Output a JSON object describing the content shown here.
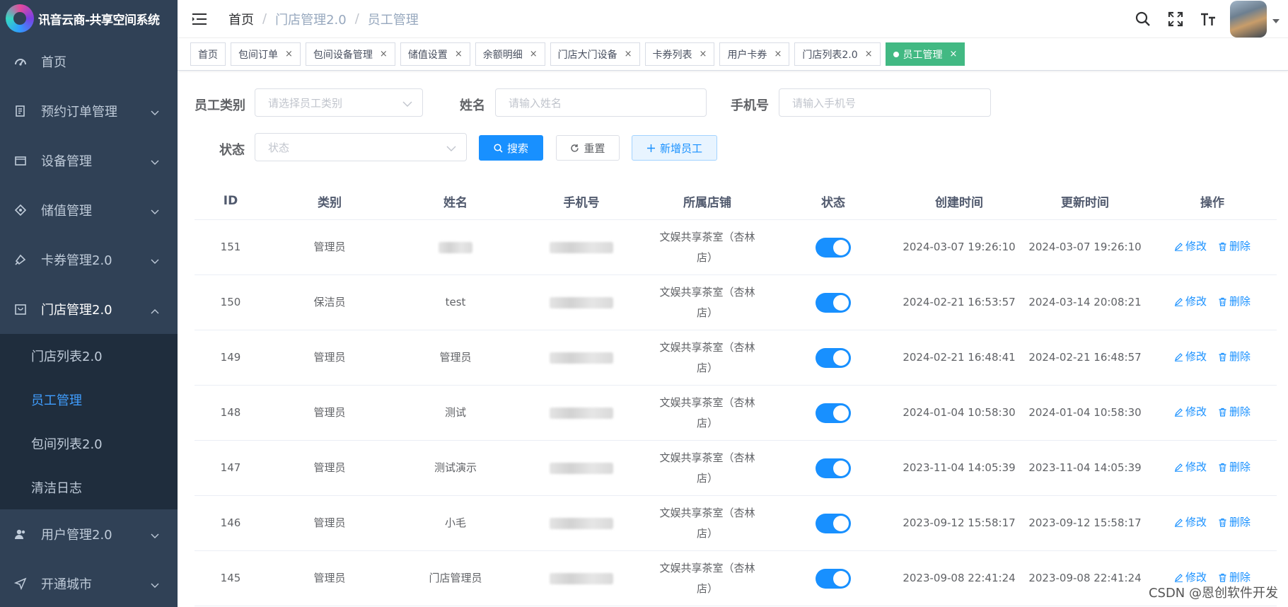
{
  "app": {
    "title": "讯音云商-共享空间系统"
  },
  "sidebar": {
    "items": [
      {
        "label": "首页",
        "icon": "dashboard-icon"
      },
      {
        "label": "预约订单管理",
        "icon": "order-icon"
      },
      {
        "label": "设备管理",
        "icon": "device-icon"
      },
      {
        "label": "储值管理",
        "icon": "wallet-icon"
      },
      {
        "label": "卡券管理2.0",
        "icon": "coupon-icon"
      },
      {
        "label": "门店管理2.0",
        "icon": "store-icon"
      },
      {
        "label": "用户管理2.0",
        "icon": "user-icon"
      },
      {
        "label": "开通城市",
        "icon": "send-icon"
      }
    ],
    "submenu": [
      {
        "label": "门店列表2.0"
      },
      {
        "label": "员工管理"
      },
      {
        "label": "包间列表2.0"
      },
      {
        "label": "清洁日志"
      }
    ]
  },
  "breadcrumb": [
    "首页",
    "门店管理2.0",
    "员工管理"
  ],
  "tags": [
    {
      "label": "首页",
      "closable": false
    },
    {
      "label": "包间订单",
      "closable": true
    },
    {
      "label": "包间设备管理",
      "closable": true
    },
    {
      "label": "储值设置",
      "closable": true
    },
    {
      "label": "余额明细",
      "closable": true
    },
    {
      "label": "门店大门设备",
      "closable": true
    },
    {
      "label": "卡券列表",
      "closable": true
    },
    {
      "label": "用户卡券",
      "closable": true
    },
    {
      "label": "门店列表2.0",
      "closable": true
    },
    {
      "label": "员工管理",
      "closable": true,
      "active": true
    }
  ],
  "filters": {
    "type_label": "员工类别",
    "type_placeholder": "请选择员工类别",
    "name_label": "姓名",
    "name_placeholder": "请输入姓名",
    "phone_label": "手机号",
    "phone_placeholder": "请输入手机号",
    "status_label": "状态",
    "status_placeholder": "状态"
  },
  "buttons": {
    "search": "搜索",
    "reset": "重置",
    "add": "新增员工"
  },
  "table": {
    "headers": [
      "ID",
      "类别",
      "姓名",
      "手机号",
      "所属店铺",
      "状态",
      "创建时间",
      "更新时间",
      "操作"
    ],
    "edit_label": "修改",
    "delete_label": "删除",
    "rows": [
      {
        "id": "151",
        "type": "管理员",
        "name": "",
        "store": "文娱共享茶室（杏林店）",
        "status": true,
        "created": "2024-03-07 19:26:10",
        "updated": "2024-03-07 19:26:10"
      },
      {
        "id": "150",
        "type": "保洁员",
        "name": "test",
        "store": "文娱共享茶室（杏林店）",
        "status": true,
        "created": "2024-02-21 16:53:57",
        "updated": "2024-03-14 20:08:21"
      },
      {
        "id": "149",
        "type": "管理员",
        "name": "管理员",
        "store": "文娱共享茶室（杏林店）",
        "status": true,
        "created": "2024-02-21 16:48:41",
        "updated": "2024-02-21 16:48:57"
      },
      {
        "id": "148",
        "type": "管理员",
        "name": "测试",
        "store": "文娱共享茶室（杏林店）",
        "status": true,
        "created": "2024-01-04 10:58:30",
        "updated": "2024-01-04 10:58:30"
      },
      {
        "id": "147",
        "type": "管理员",
        "name": "测试演示",
        "store": "文娱共享茶室（杏林店）",
        "status": true,
        "created": "2023-11-04 14:05:39",
        "updated": "2023-11-04 14:05:39"
      },
      {
        "id": "146",
        "type": "管理员",
        "name": "小毛",
        "store": "文娱共享茶室（杏林店）",
        "status": true,
        "created": "2023-09-12 15:58:17",
        "updated": "2023-09-12 15:58:17"
      },
      {
        "id": "145",
        "type": "管理员",
        "name": "门店管理员",
        "store": "文娱共享茶室（杏林店）",
        "status": true,
        "created": "2023-09-08 22:41:24",
        "updated": "2023-09-08 22:41:24"
      }
    ]
  },
  "watermark": "CSDN @恩创软件开发",
  "colors": {
    "sidebar_bg": "#304156",
    "submenu_bg": "#1f2d3d",
    "primary": "#1890ff",
    "tag_active": "#42b983"
  }
}
